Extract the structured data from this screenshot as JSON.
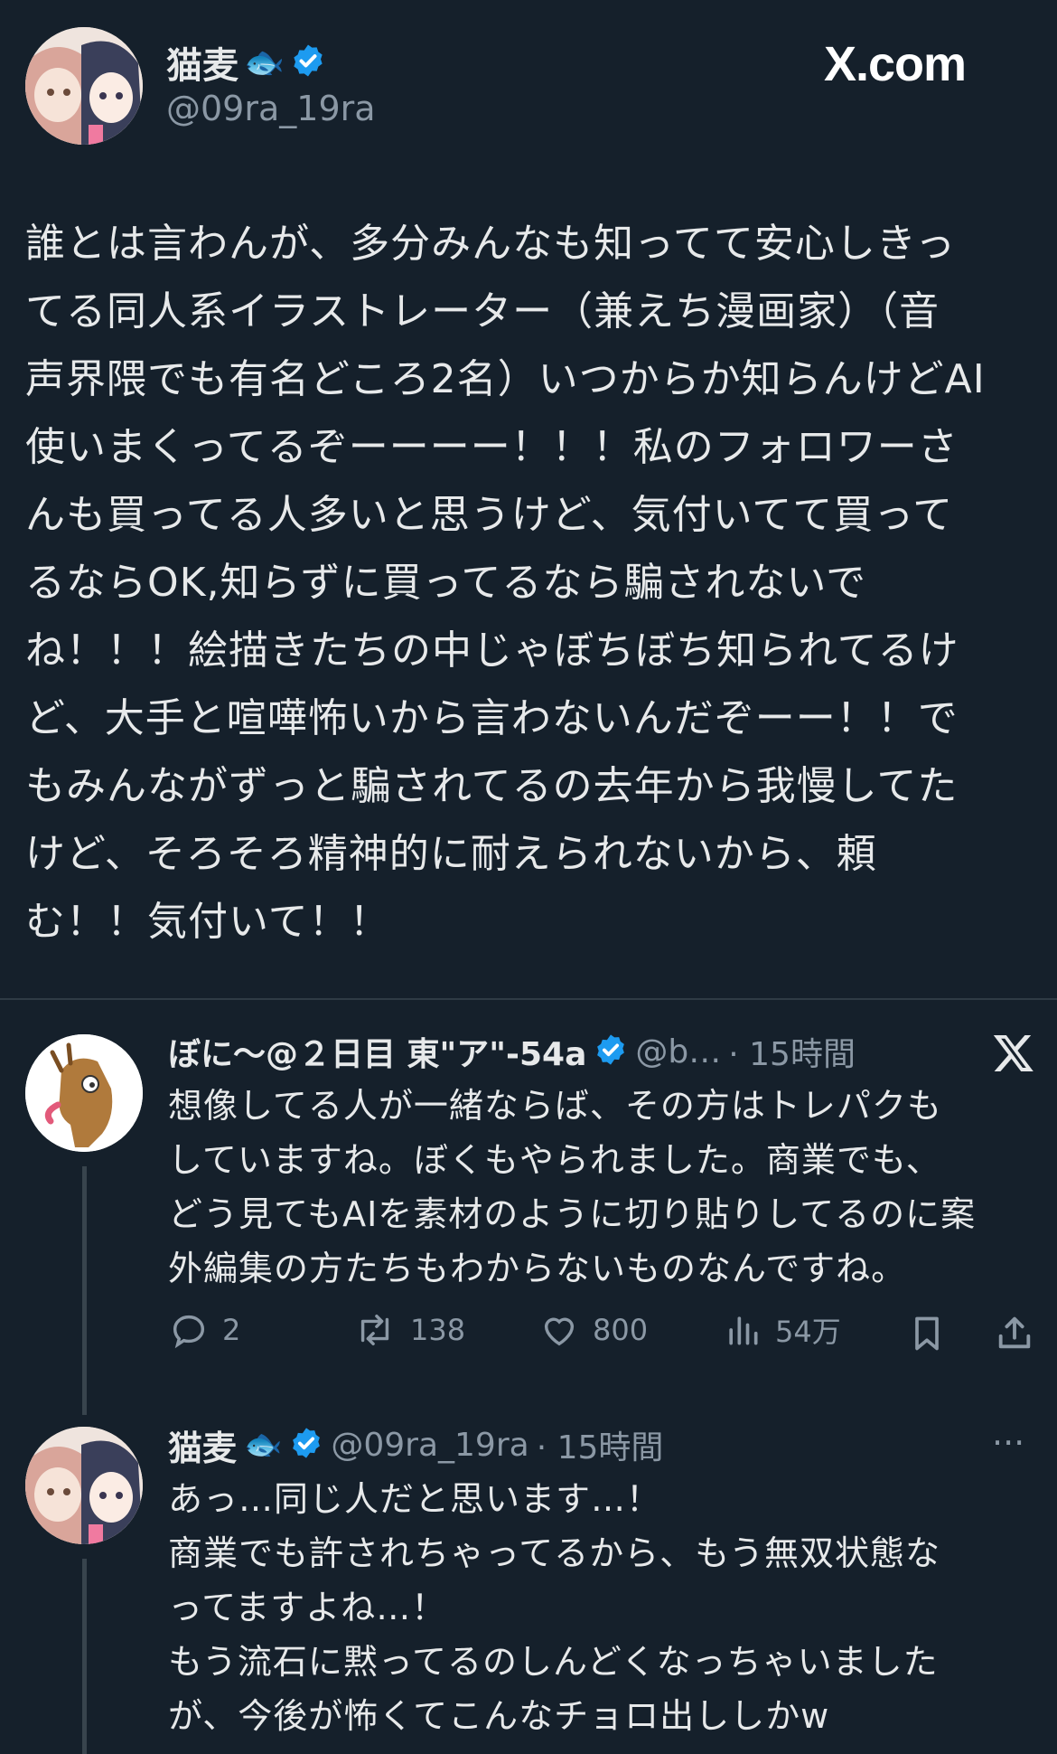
{
  "header": {
    "display_name": "猫麦",
    "name_emoji": "🐟",
    "handle": "@09ra_19ra",
    "site_logo": "X.com"
  },
  "main_post": {
    "text": "誰とは言わんが、多分みんなも知ってて安心しきっ\nてる同人系イラストレーター（兼えち漫画家）（音\n声界隈でも有名どころ2名）いつからか知らんけどAI\n使いまくってるぞーーーー！！！私のフォロワーさ\nんも買ってる人多いと思うけど、気付いてて買って\nるならOK,知らずに買ってるなら騙されないで\nね！！！絵描きたちの中じゃぼちぼち知られてるけ\nど、大手と喧嘩怖いから言わないんだぞーー！！で\nもみんながずっと騙されてるの去年から我慢してた\nけど、そろそろ精神的に耐えられないから、頼\nむ！！気付いて！！"
  },
  "reply1": {
    "display_name": "ぼに～@２日目 東\"ア\"-54a",
    "handle": "@b…",
    "time": "· 15時間",
    "text": "想像してる人が一緒ならば、その方はトレパクも\nしていますね。ぼくもやられました。商業でも、\nどう見てもAIを素材のように切り貼りしてるのに案\n外編集の方たちもわからないものなんですね。",
    "actions": {
      "replies": "2",
      "reposts": "138",
      "likes": "800",
      "views": "54万"
    }
  },
  "reply2": {
    "display_name": "猫麦",
    "name_emoji": "🐟",
    "handle": "@09ra_19ra",
    "time": "· 15時間",
    "more": "···",
    "text": "あっ…同じ人だと思います…！\n商業でも許されちゃってるから、もう無双状態な\nってますよね…！\nもう流石に黙ってるのしんどくなっちゃいました\nが、今後が怖くてこんなチョロ出ししかw"
  },
  "colors": {
    "background": "#15202b",
    "text": "#e7e9ea",
    "secondary": "#8b98a5",
    "verified": "#1d9bf0"
  }
}
